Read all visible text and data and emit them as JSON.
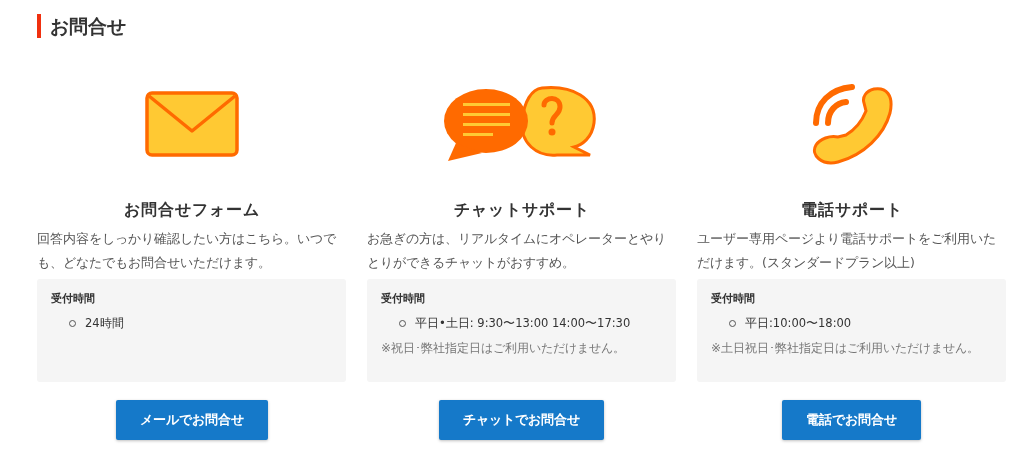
{
  "heading": "お問合せ",
  "cards": [
    {
      "kind": "mail",
      "title": "お問合せフォーム",
      "description": "回答内容をしっかり確認したい方はこちら。いつでも、どなたでもお問合せいただけます。",
      "hours_label": "受付時間",
      "hours": [
        "24時間"
      ],
      "button": "メールでお問合せ"
    },
    {
      "kind": "chat",
      "title": "チャットサポート",
      "description": "お急ぎの方は、リアルタイムにオペレーターとやりとりができるチャットがおすすめ。",
      "hours_label": "受付時間",
      "hours": [
        "平日•土日: 9:30〜13:00 14:00〜17:30"
      ],
      "note": "※祝日･弊社指定日はご利用いただけません。",
      "button": "チャットでお問合せ"
    },
    {
      "kind": "phone",
      "title": "電話サポート",
      "description": "ユーザー専用ページより電話サポートをご利用いただけます。(スタンダードプラン以上)",
      "hours_label": "受付時間",
      "hours": [
        "平日:10:00〜18:00"
      ],
      "note": "※土日祝日･弊社指定日はご利用いただけません。",
      "button": "電話でお問合せ"
    }
  ]
}
